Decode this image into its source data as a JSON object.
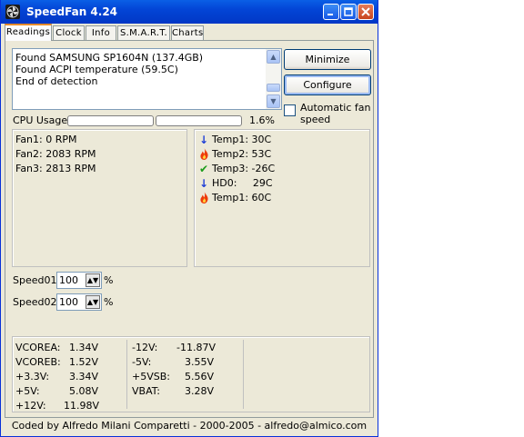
{
  "window": {
    "title": "SpeedFan 4.24"
  },
  "tabs": [
    {
      "label": "Readings"
    },
    {
      "label": "Clock"
    },
    {
      "label": "Info"
    },
    {
      "label": "S.M.A.R.T."
    },
    {
      "label": "Charts"
    }
  ],
  "log": [
    "Found SAMSUNG SP1604N (137.4GB)",
    "Found ACPI temperature (59.5C)",
    "End of detection"
  ],
  "buttons": {
    "minimize": "Minimize",
    "configure": "Configure"
  },
  "auto_fan": {
    "label": "Automatic fan speed",
    "checked": false
  },
  "cpu": {
    "label": "CPU Usage",
    "value_text": "1.6%",
    "core1_fraction": 0.0,
    "core2_fraction": 0.0
  },
  "fans": [
    "Fan1: 0 RPM",
    "Fan2: 2083 RPM",
    "Fan3: 2813 RPM"
  ],
  "temps": [
    {
      "label": "Temp1: 30C",
      "icon": "arrow-down-icon",
      "color": "#1f3fd6"
    },
    {
      "label": "Temp2: 53C",
      "icon": "flame-icon",
      "color": "#e23b0b"
    },
    {
      "label": "Temp3: -26C",
      "icon": "check-icon",
      "color": "#1a9c1a"
    },
    {
      "label": "HD0:     29C",
      "icon": "arrow-down-icon",
      "color": "#1f3fd6"
    },
    {
      "label": "Temp1: 60C",
      "icon": "flame-icon",
      "color": "#e23b0b"
    }
  ],
  "speeds": [
    {
      "label": "Speed01:",
      "value": "100",
      "unit": "%"
    },
    {
      "label": "Speed02:",
      "value": "100",
      "unit": "%"
    }
  ],
  "voltages": {
    "col1": [
      {
        "name": "VCOREA:",
        "value": "1.34V"
      },
      {
        "name": "VCOREB:",
        "value": "1.52V"
      },
      {
        "name": "+3.3V:",
        "value": "3.34V"
      },
      {
        "name": "+5V:",
        "value": "5.08V"
      },
      {
        "name": "+12V:",
        "value": "11.98V"
      }
    ],
    "col2": [
      {
        "name": "-12V:",
        "value": "-11.87V"
      },
      {
        "name": "-5V:",
        "value": "3.55V"
      },
      {
        "name": "+5VSB:",
        "value": "5.56V"
      },
      {
        "name": "VBAT:",
        "value": "3.28V"
      }
    ]
  },
  "credits": "Coded by Alfredo Milani Comparetti - 2000-2005 - alfredo@almico.com"
}
